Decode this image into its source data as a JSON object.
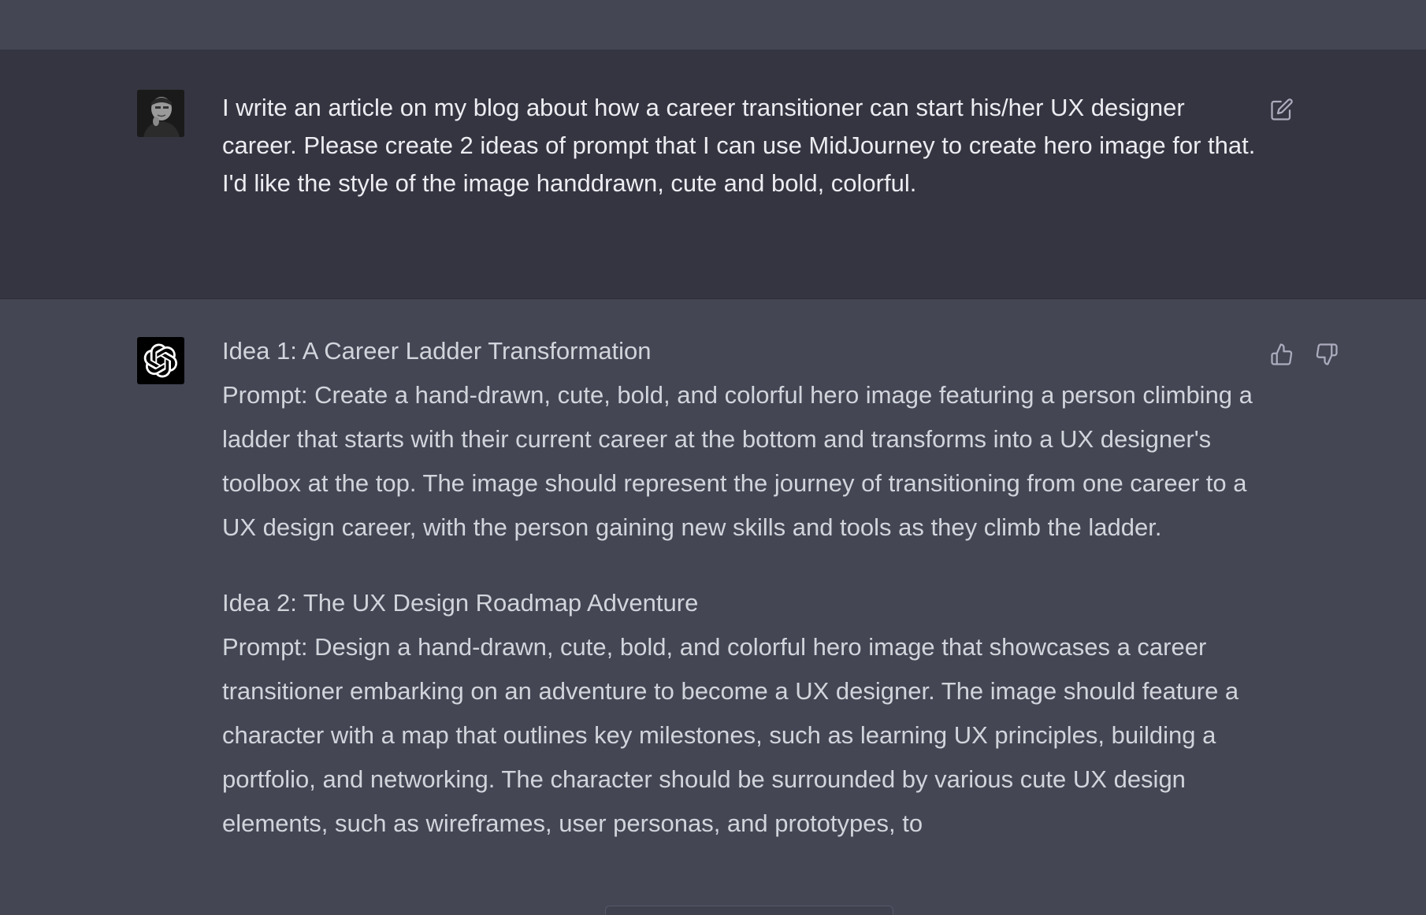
{
  "user_message": {
    "text": "I write an article on my blog about how a career transitioner can start his/her UX designer career. Please create 2 ideas of prompt that I can use MidJourney to create hero image for that. I'd like the style of the image handdrawn, cute and bold, colorful.",
    "avatar": "user-photo-avatar",
    "action_icon": "edit-icon"
  },
  "assistant_message": {
    "avatar": "openai-logo-icon",
    "ideas": [
      {
        "title": "Idea 1: A Career Ladder Transformation",
        "prompt": "Prompt: Create a hand-drawn, cute, bold, and colorful hero image featuring a person climbing a ladder that starts with their current career at the bottom and transforms into a UX designer's toolbox at the top. The image should represent the journey of transitioning from one career to a UX design career, with the person gaining new skills and tools as they climb the ladder."
      },
      {
        "title": "Idea 2: The UX Design Roadmap Adventure",
        "prompt": "Prompt: Design a hand-drawn, cute, bold, and colorful hero image that showcases a career transitioner embarking on an adventure to become a UX designer. The image should feature a character with a map that outlines key milestones, such as learning UX principles, building a portfolio, and networking. The character should be surrounded by various cute UX design elements, such as wireframes, user personas, and prototypes, to"
      }
    ],
    "feedback_icons": [
      "thumbs-up-icon",
      "thumbs-down-icon"
    ]
  },
  "colors": {
    "page_bg": "#444654",
    "user_bg": "#343541",
    "user_text": "#ececf1",
    "assistant_text": "#d1d5db",
    "icon": "#acacbe"
  }
}
